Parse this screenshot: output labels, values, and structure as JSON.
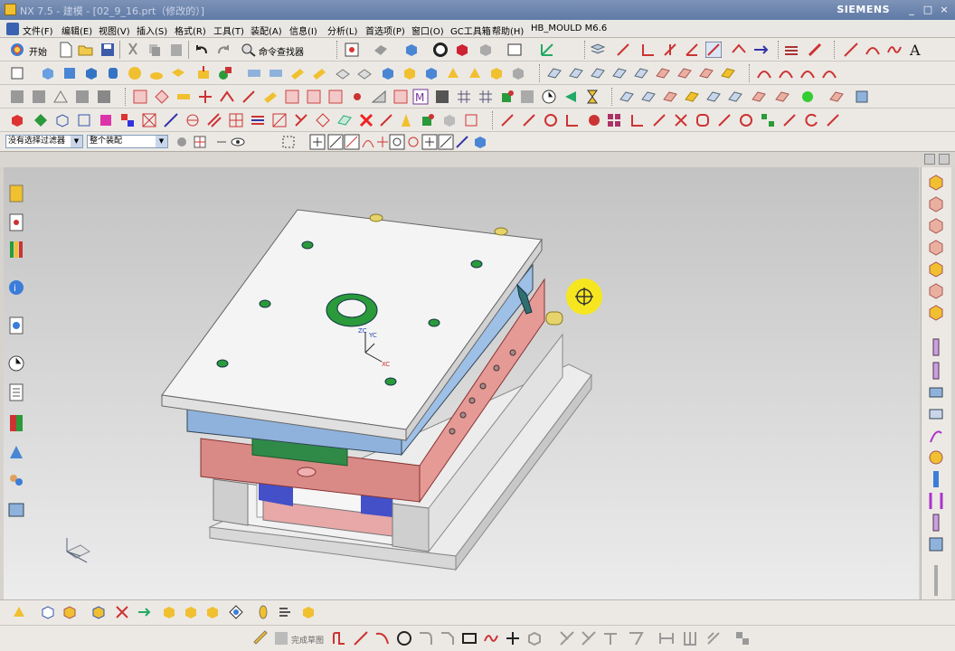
{
  "window": {
    "title": "NX 7.5 - 建模 - [02_9_16.prt（修改的）]",
    "brand": "SIEMENS",
    "controls": [
      "_",
      "□",
      "×"
    ]
  },
  "menubar": {
    "items": [
      "文件(F)",
      "编辑(E)",
      "视图(V)",
      "插入(S)",
      "格式(R)",
      "工具(T)",
      "装配(A)",
      "信息(I)",
      "分析(L)",
      "首选项(P)",
      "窗口(O)",
      "GC工具箱",
      "帮助(H)",
      "HB_MOULD  M6.6"
    ]
  },
  "standard_toolbar": {
    "start_label": "开始",
    "command_finder_label": "命令查找器"
  },
  "selection_bar": {
    "filter_value": "没有选择过滤器",
    "scope_value": "整个装配"
  },
  "sketch_toolbar": {
    "finish_label": "完成草图"
  },
  "viewport": {
    "wcs_labels": [
      "ZC",
      "YC",
      "XC"
    ]
  },
  "colors": {
    "title_bar": "#6a83ad",
    "viewport_top": "#c3c3c3",
    "viewport_bottom": "#ececec",
    "plate_top": "#ececec",
    "plate_blue": "#8fb2dc",
    "plate_red": "#d98a86",
    "bolt_green": "#2a9a3a"
  }
}
